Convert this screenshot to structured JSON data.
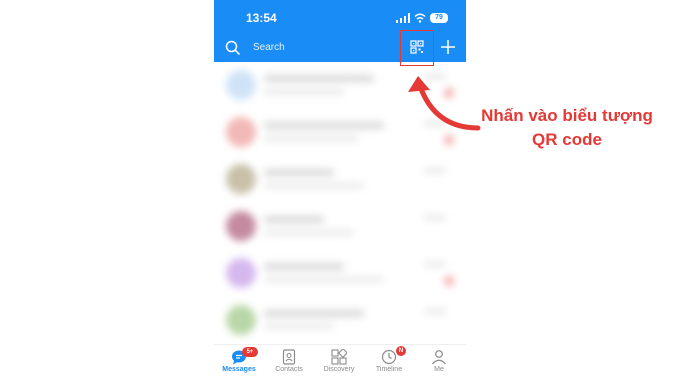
{
  "status_bar": {
    "time": "13:54",
    "battery": "79"
  },
  "header": {
    "search_placeholder": "Search"
  },
  "tabs": [
    {
      "label": "Messages",
      "badge": "5+",
      "active": true,
      "icon": "chat-bubble-icon"
    },
    {
      "label": "Contacts",
      "badge": "",
      "active": false,
      "icon": "contact-card-icon"
    },
    {
      "label": "Discovery",
      "badge": "",
      "active": false,
      "icon": "grid-icon"
    },
    {
      "label": "Timeline",
      "badge": "N",
      "active": false,
      "icon": "clock-icon"
    },
    {
      "label": "Me",
      "badge": "",
      "active": false,
      "icon": "person-icon"
    }
  ],
  "annotation": {
    "line1": "Nhấn vào biểu tượng",
    "line2": "QR code"
  },
  "colors": {
    "brand": "#1a8cf6",
    "annotation": "#e53935"
  }
}
